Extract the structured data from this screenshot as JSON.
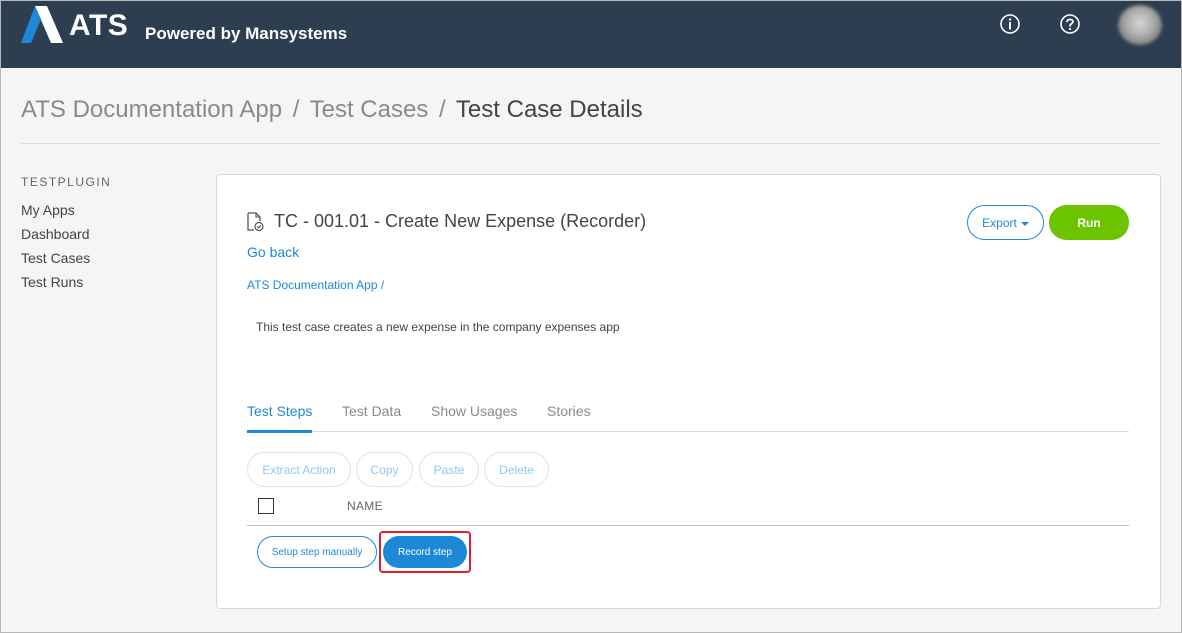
{
  "header": {
    "logo_text": "ATS",
    "tagline": "Powered by Mansystems",
    "icons": [
      "info-icon",
      "help-icon"
    ],
    "colors": {
      "background": "#2c3e50",
      "logo_accent": "#1e88d8"
    }
  },
  "breadcrumb": {
    "items": [
      "ATS Documentation App",
      "Test Cases",
      "Test Case Details"
    ],
    "separator": "/"
  },
  "sidebar": {
    "heading": "TESTPLUGIN",
    "items": [
      {
        "label": "My Apps"
      },
      {
        "label": "Dashboard"
      },
      {
        "label": "Test Cases"
      },
      {
        "label": "Test Runs"
      }
    ]
  },
  "test_case": {
    "title": "TC - 001.01 - Create New Expense (Recorder)",
    "go_back": "Go back",
    "app_link": "ATS Documentation App /",
    "description": "This test case creates a new expense in the company expenses app",
    "export_label": "Export",
    "run_label": "Run"
  },
  "tabs": [
    {
      "label": "Test Steps",
      "active": true
    },
    {
      "label": "Test Data",
      "active": false
    },
    {
      "label": "Show Usages",
      "active": false
    },
    {
      "label": "Stories",
      "active": false
    }
  ],
  "step_actions": [
    {
      "label": "Extract Action"
    },
    {
      "label": "Copy"
    },
    {
      "label": "Paste"
    },
    {
      "label": "Delete"
    }
  ],
  "table": {
    "column_name": "NAME",
    "select_all_checked": false
  },
  "step_buttons": {
    "setup_manual": "Setup step manually",
    "record": "Record step",
    "highlight_color": "#e0202a"
  },
  "colors": {
    "primary": "#1e88d8",
    "run": "#6cc400"
  }
}
